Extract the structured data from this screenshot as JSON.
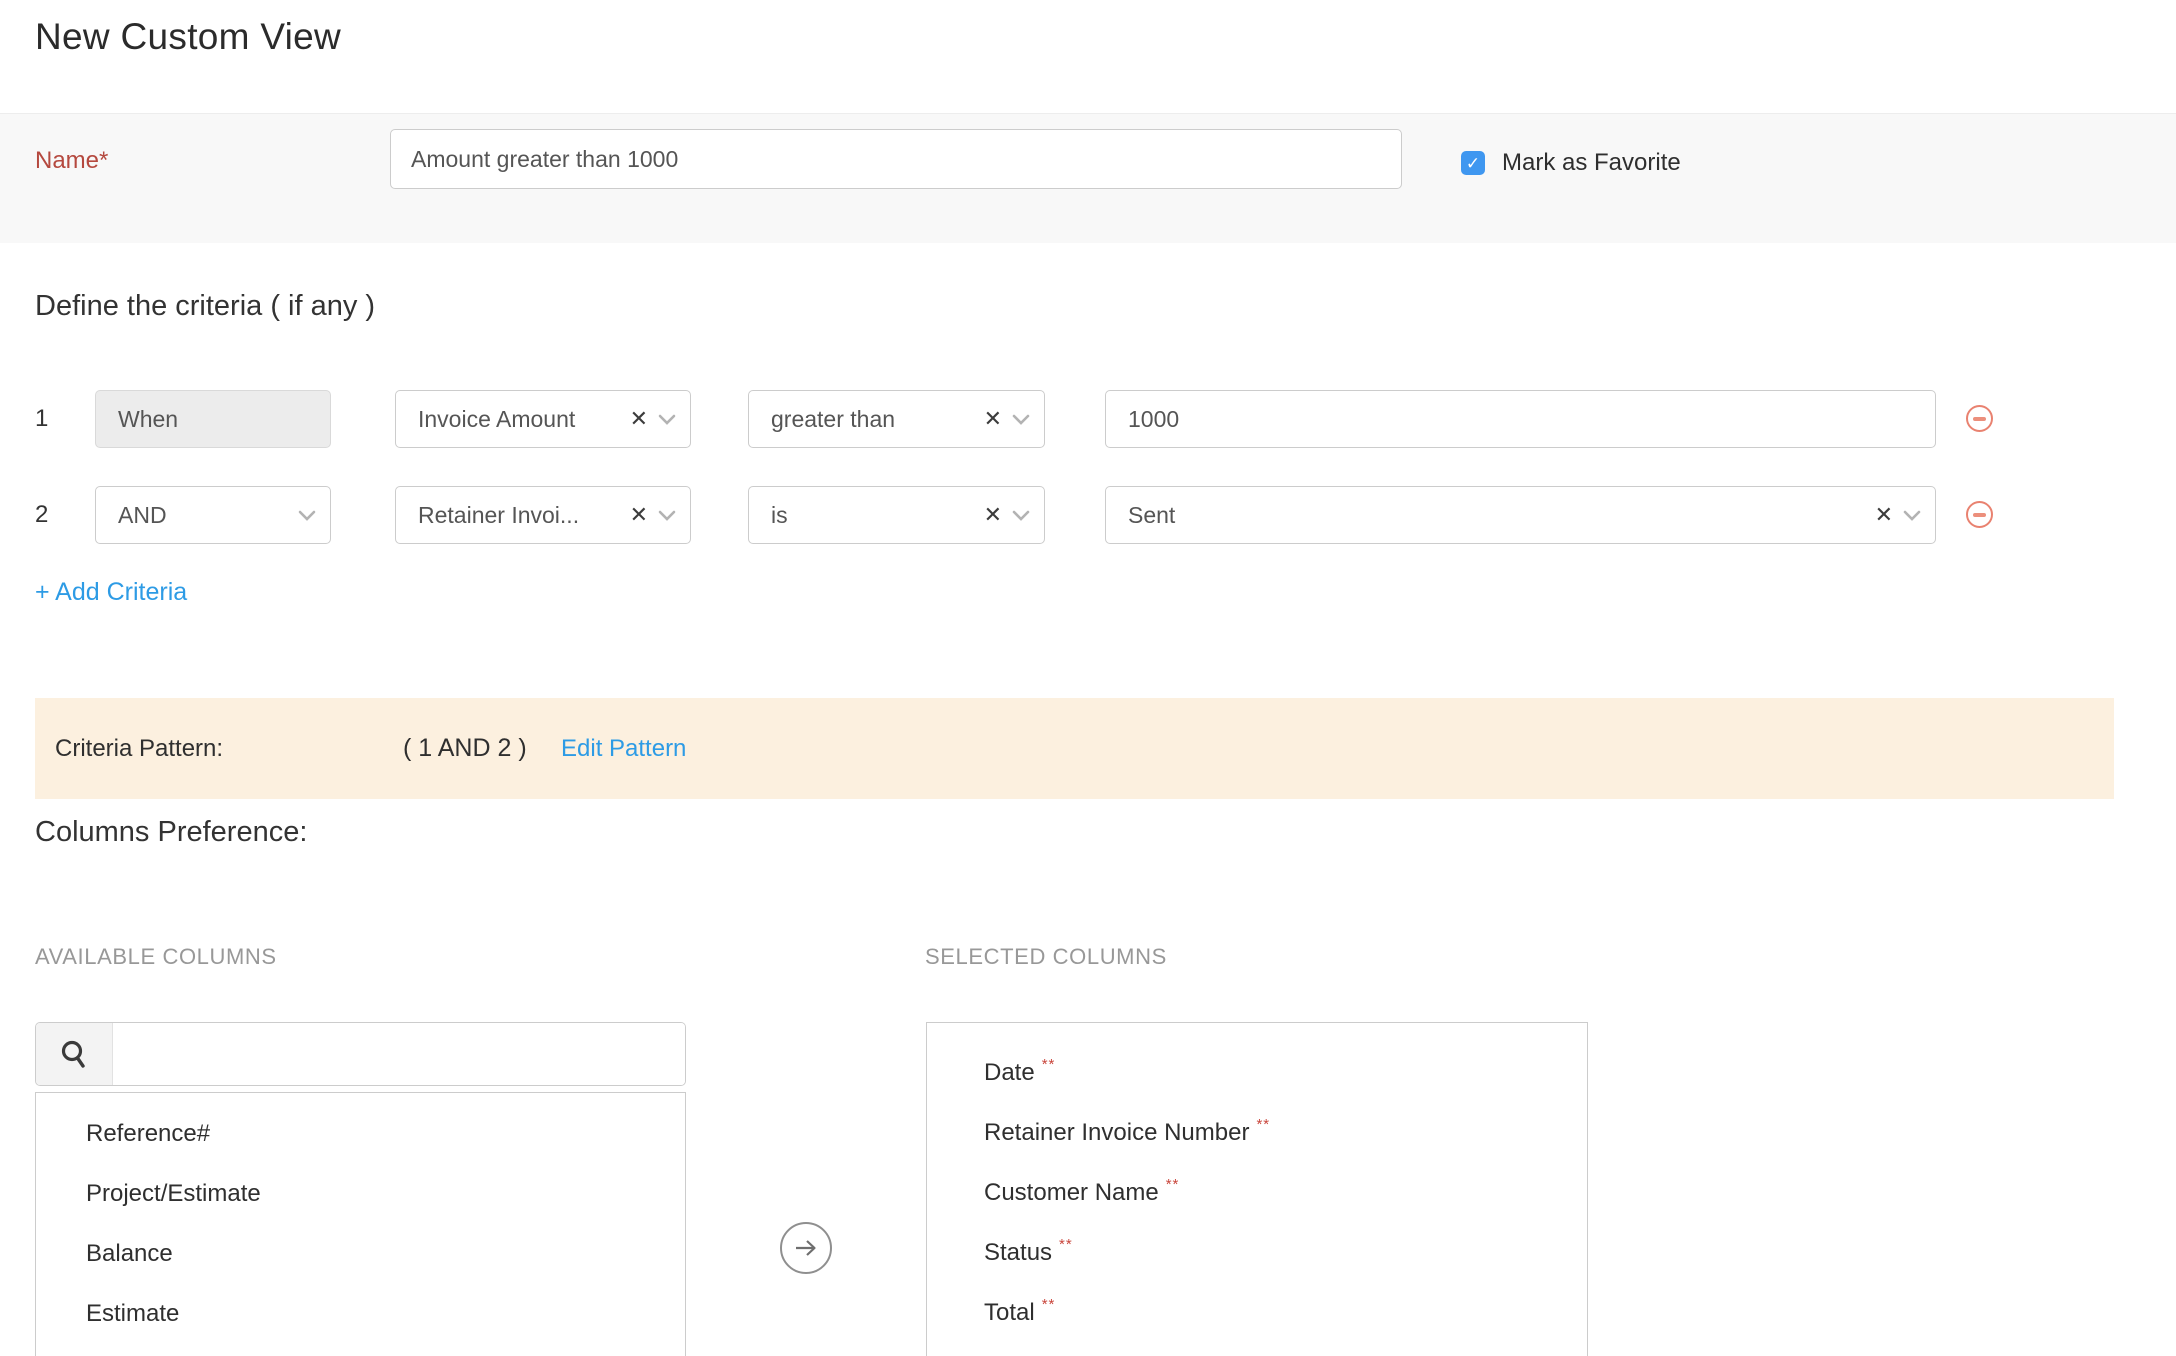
{
  "page": {
    "title": "New Custom View"
  },
  "name_section": {
    "label": "Name*",
    "value": "Amount greater than 1000",
    "favorite_label": "Mark as Favorite",
    "favorite_checked": true
  },
  "criteria": {
    "heading": "Define the criteria ( if any )",
    "rows": [
      {
        "index": "1",
        "connector": "When",
        "field": "Invoice Amount",
        "operator": "greater than",
        "value": "1000"
      },
      {
        "index": "2",
        "connector": "AND",
        "field": "Retainer Invoi...",
        "operator": "is",
        "value": "Sent"
      }
    ],
    "add_link": "+ Add Criteria",
    "pattern_label": "Criteria Pattern:",
    "pattern_value": "( 1 AND 2 )",
    "edit_link": "Edit Pattern"
  },
  "columns": {
    "heading": "Columns Preference:",
    "available_header": "AVAILABLE COLUMNS",
    "selected_header": "SELECTED COLUMNS",
    "available_items": [
      "Reference#",
      "Project/Estimate",
      "Balance",
      "Estimate"
    ],
    "selected_items": [
      {
        "label": "Date",
        "required": "**"
      },
      {
        "label": "Retainer Invoice Number",
        "required": "**"
      },
      {
        "label": "Customer Name",
        "required": "**"
      },
      {
        "label": "Status",
        "required": "**"
      },
      {
        "label": "Total",
        "required": "**"
      }
    ]
  },
  "icons": {
    "check": "✓",
    "remove": "✕"
  },
  "colors": {
    "accent_blue": "#2d9be5",
    "checkbox_blue": "#3f97f0",
    "label_red": "#b5493f",
    "required_red": "#c9463c",
    "minus_coral": "#e98270",
    "pattern_band": "#fcf0df",
    "name_band": "#f8f8f8"
  }
}
